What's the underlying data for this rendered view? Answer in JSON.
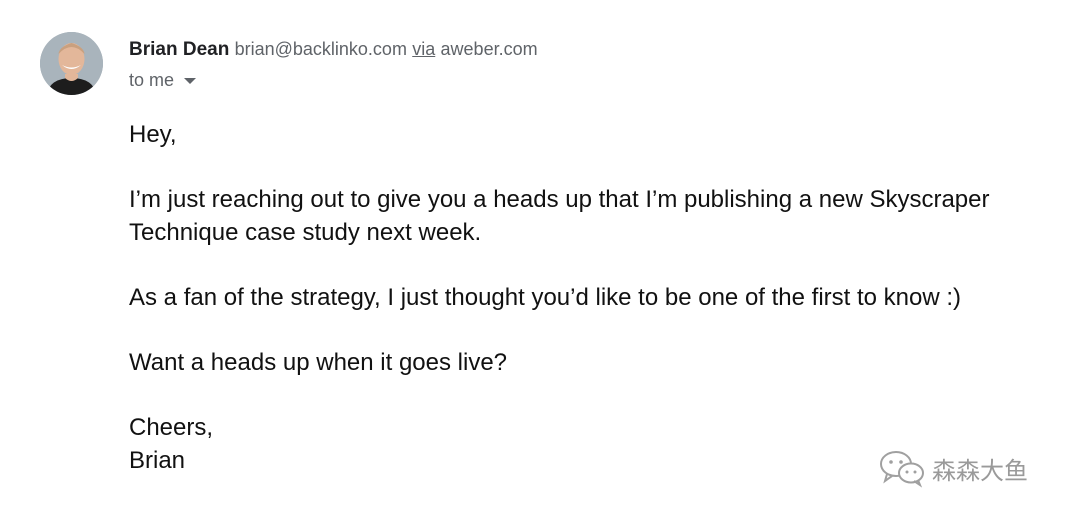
{
  "sender": {
    "name": "Brian Dean",
    "email": "brian@backlinko.com",
    "via_label": "via",
    "via_domain": "aweber.com"
  },
  "recipient": {
    "label": "to me"
  },
  "message": {
    "greeting": "Hey,",
    "paragraph_1": "I’m just reaching out to give you a heads up that I’m publishing a new Skyscraper Technique case study next week.",
    "paragraph_2": "As a fan of the strategy, I just thought you’d like to be one of the first to know :)",
    "paragraph_3": "Want a heads up when it goes live?",
    "signoff": "Cheers,",
    "signature": "Brian"
  },
  "watermark": {
    "text": "森森大鱼"
  },
  "icons": {
    "avatar": "person-avatar",
    "caret": "caret-down-icon",
    "watermark": "wechat-icon"
  }
}
